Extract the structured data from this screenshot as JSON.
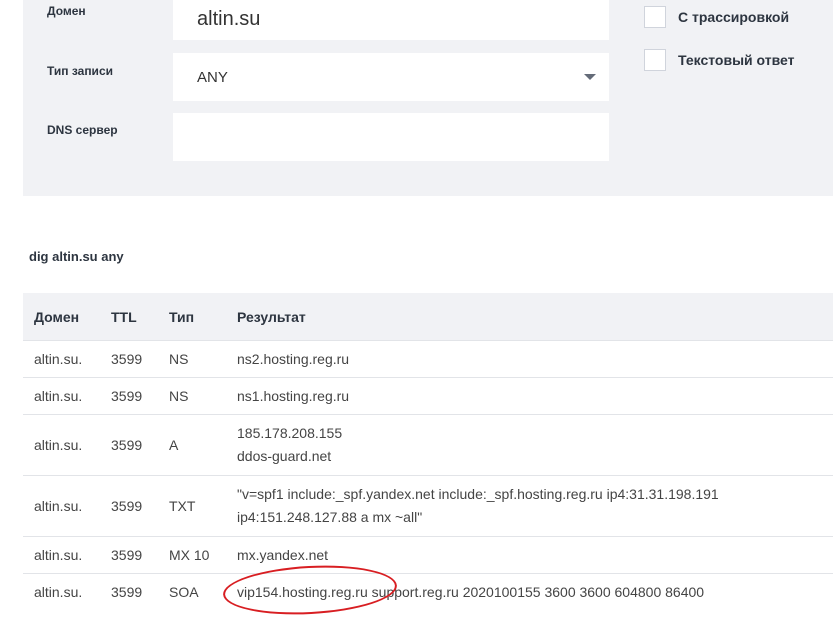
{
  "form": {
    "domain_label": "Домен",
    "domain_value": "altin.su",
    "type_label": "Тип записи",
    "type_value": "ANY",
    "dns_label": "DNS сервер",
    "dns_value": "",
    "trace_label": "С трассировкой",
    "trace_checked": false,
    "text_label": "Текстовый ответ",
    "text_checked": false
  },
  "command": "dig altin.su any",
  "table": {
    "headers": [
      "Домен",
      "TTL",
      "Тип",
      "Результат"
    ],
    "rows": [
      {
        "domain": "altin.su.",
        "ttl": "3599",
        "type": "NS",
        "result": [
          "ns2.hosting.reg.ru"
        ]
      },
      {
        "domain": "altin.su.",
        "ttl": "3599",
        "type": "NS",
        "result": [
          "ns1.hosting.reg.ru"
        ]
      },
      {
        "domain": "altin.su.",
        "ttl": "3599",
        "type": "A",
        "result": [
          "185.178.208.155",
          "ddos-guard.net"
        ]
      },
      {
        "domain": "altin.su.",
        "ttl": "3599",
        "type": "TXT",
        "result": [
          "\"v=spf1 include:_spf.yandex.net include:_spf.hosting.reg.ru ip4:31.31.198.191",
          "ip4:151.248.127.88 a mx ~all\""
        ]
      },
      {
        "domain": "altin.su.",
        "ttl": "3599",
        "type": "MX 10",
        "result": [
          "mx.yandex.net"
        ]
      },
      {
        "domain": "altin.su.",
        "ttl": "3599",
        "type": "SOA",
        "result": [
          "vip154.hosting.reg.ru",
          " support.reg.ru 2020100155 3600 3600 604800 86400"
        ]
      }
    ]
  },
  "colors": {
    "panel_bg": "#f1f2f5",
    "annotation_ring": "#d81e22"
  }
}
